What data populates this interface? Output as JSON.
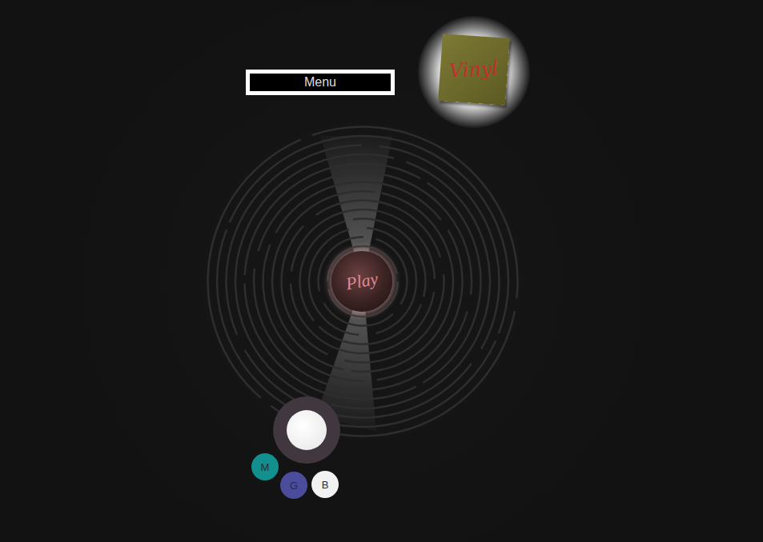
{
  "menu_button": {
    "label": "Menu"
  },
  "vinyl_cover": {
    "label": "Vinyl"
  },
  "play_button": {
    "label": "Play"
  },
  "action_buttons": [
    {
      "label": "M",
      "color": "#128f8f"
    },
    {
      "label": "G",
      "color": "#4b4d9c"
    },
    {
      "label": "B",
      "color": "#f2f2f2"
    }
  ]
}
